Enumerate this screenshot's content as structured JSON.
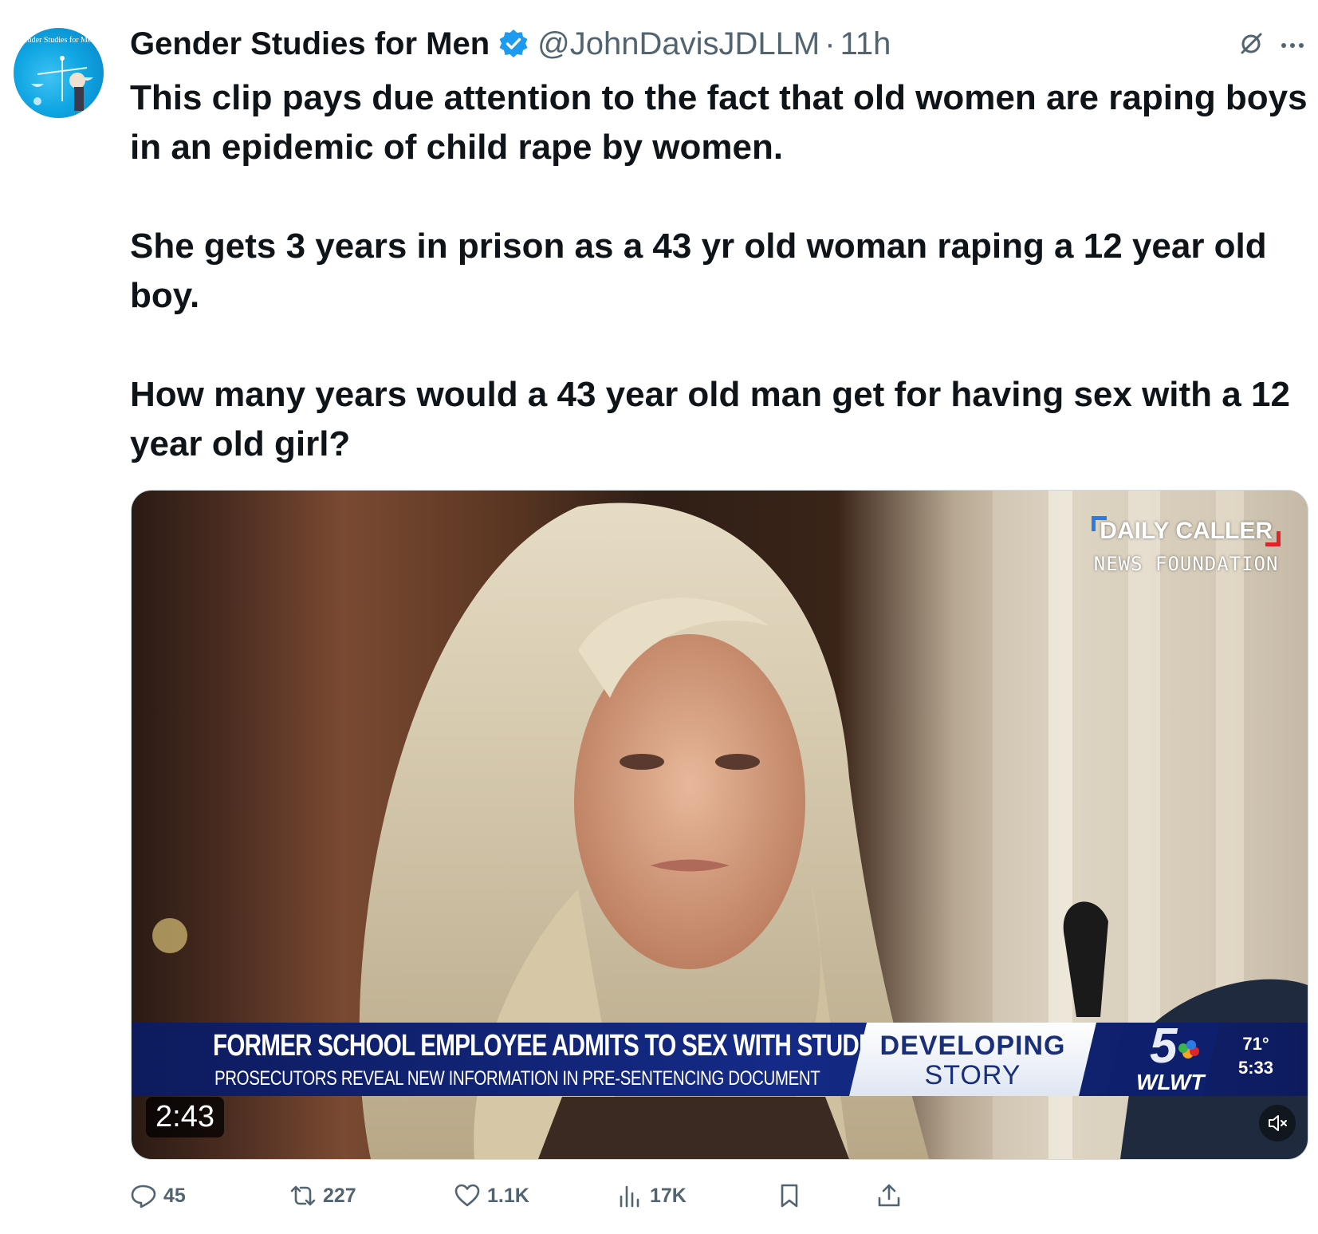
{
  "avatar": {
    "text": "Gender Studies for Men"
  },
  "header": {
    "name": "Gender Studies for Men",
    "handle": "@JohnDavisJDLLM",
    "separator": "·",
    "time": "11h"
  },
  "tweet": {
    "paragraph1": "This clip pays due attention to the fact that old women are raping boys in an epidemic of child rape by women.",
    "paragraph2": "She gets 3 years in prison as a 43 yr old woman raping a 12 year old boy.",
    "paragraph3": "How many years would a 43 year old man get for having sex with a 12 year old girl?"
  },
  "video": {
    "watermark_title": "DAILY CALLER",
    "watermark_sub": "NEWS FOUNDATION",
    "headline": "FORMER SCHOOL EMPLOYEE ADMITS TO SEX WITH STUDENT",
    "subheadline": "PROSECUTORS REVEAL NEW INFORMATION IN PRE-SENTENCING DOCUMENT",
    "tag_line1": "DEVELOPING",
    "tag_line2": "STORY",
    "station_number": "5",
    "station_name": "WLWT",
    "temperature": "71°",
    "clock": "5:33",
    "duration": "2:43",
    "mute_icon": "speaker-muted-icon"
  },
  "actions": {
    "replies": "45",
    "reposts": "227",
    "likes": "1.1K",
    "views": "17K"
  },
  "colors": {
    "verified": "#1d9bf0",
    "muted_text": "#536471",
    "text": "#0f1419",
    "banner_blue": "#142a86"
  }
}
